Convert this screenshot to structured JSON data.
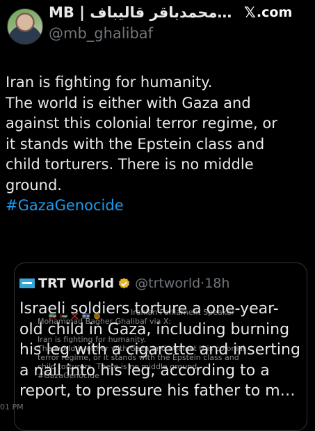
{
  "header": {
    "display_name": "MB | محمدباقر قالیباف…",
    "handle": "@mb_ghalibaf",
    "site_label": ".com"
  },
  "tweet": {
    "lines": [
      "Iran is fighting for humanity.",
      "The world is either with Gaza and",
      "against this colonial terror regime, or",
      "it stands with the Epstein class and",
      "child torturers. There is no middle",
      "ground."
    ],
    "hashtag": "#GazaGenocide"
  },
  "quote": {
    "name": "TRT World",
    "handle": "@trtworld",
    "separator": "·",
    "age": "18h",
    "lines": [
      "Israeli soldiers torture a one-year-",
      "old child in Gaza, including burning",
      "his leg with a cigarette and inserting",
      "a nail into his leg, according to a",
      "report, to pressure his father to m…"
    ]
  },
  "overlay": {
    "lines": [
      "Iranian Parliament Speaker",
      "Mohammad Bagher Ghalibaf via X:",
      "",
      "Iran is fighting for humanity.",
      "The world is either with Gaza and against this colonial",
      "terror regime, or it stands with the Epstein class and",
      "child torturers. There is no middle ground.",
      "#GazaGenocide"
    ]
  },
  "footer": {
    "time_fragment": "01 PM"
  },
  "colors": {
    "background": "#000000",
    "text": "#e7e9ea",
    "muted": "#71767b",
    "link": "#1d9bf0",
    "border": "#2f3336",
    "trt_blue": "#33a8d8",
    "verified_gold": "#e8b829"
  },
  "icons": {
    "x_logo": "x-logo-icon",
    "verified": "verified-badge-icon",
    "trt": "trt-world-logo-icon"
  }
}
